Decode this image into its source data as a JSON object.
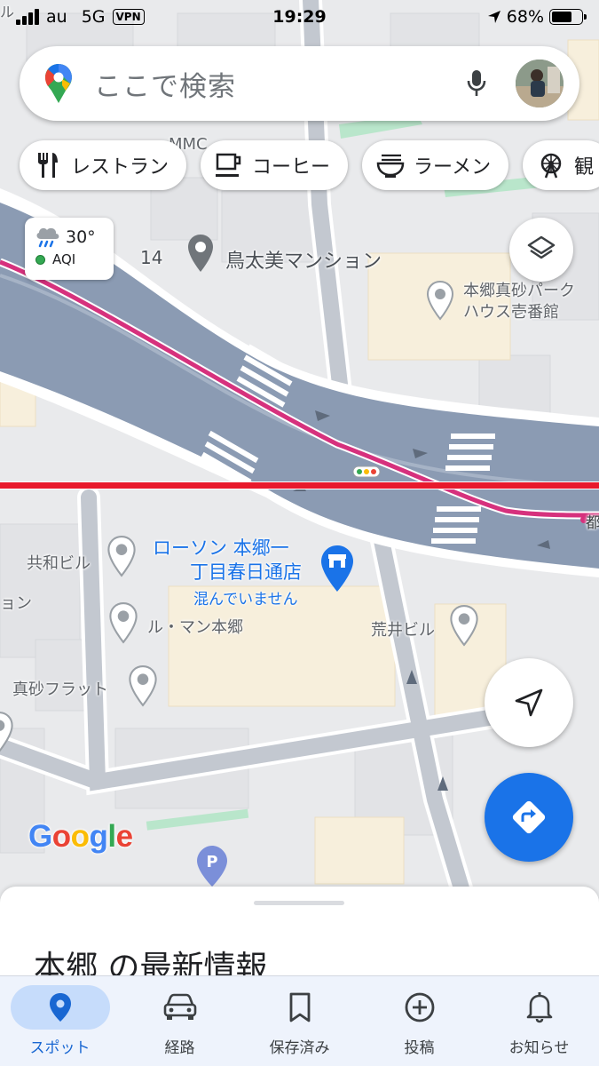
{
  "status_bar": {
    "carrier": "au",
    "network": "5G",
    "vpn": "VPN",
    "time": "19:29",
    "battery": "68%",
    "battery_level": 0.68
  },
  "search": {
    "placeholder": "ここで検索"
  },
  "chips": [
    {
      "label": "レストラン",
      "icon": "fork-knife-icon"
    },
    {
      "label": "コーヒー",
      "icon": "coffee-cup-icon"
    },
    {
      "label": "ラーメン",
      "icon": "ramen-bowl-icon"
    },
    {
      "label": "観",
      "icon": "ferris-wheel-icon"
    }
  ],
  "weather": {
    "temp": "30°",
    "aqi": "AQI",
    "icon": "rain-cloud-icon",
    "aqi_color": "#34a853"
  },
  "map": {
    "labels": {
      "mmc": "MMC",
      "num14": "14",
      "tori_mansion": "鳥太美マンション",
      "hongo_park": "本郷真砂パーク\nハウス壱番館",
      "lawson_line1": "ローソン 本郷一",
      "lawson_line2": "丁目春日通店",
      "lawson_crowd": "混んでいません",
      "kyowa": "共和ビル",
      "ru_man": "ル・マン本郷",
      "arai": "荒井ビル",
      "masago_flat": "真砂フラット",
      "yon": "ョン",
      "to": "都",
      "top_left": "ル"
    },
    "route_colors": {
      "magenta": "#d6317d",
      "red": "#e8192c"
    }
  },
  "google_logo": {
    "letters": [
      "G",
      "o",
      "o",
      "g",
      "l",
      "e"
    ],
    "colors": [
      "#4285f4",
      "#ea4335",
      "#fbbc05",
      "#4285f4",
      "#34a853",
      "#ea4335"
    ]
  },
  "sheet": {
    "title": "本郷 の最新情報"
  },
  "nav": [
    {
      "label": "スポット",
      "icon": "location-pin-icon",
      "active": true
    },
    {
      "label": "経路",
      "icon": "car-icon",
      "active": false
    },
    {
      "label": "保存済み",
      "icon": "bookmark-icon",
      "active": false
    },
    {
      "label": "投稿",
      "icon": "add-circle-icon",
      "active": false
    },
    {
      "label": "お知らせ",
      "icon": "bell-icon",
      "active": false
    }
  ],
  "colors": {
    "accent": "#1a73e8",
    "nav_bg": "#eef3fc",
    "nav_active": "#c6dcfb"
  }
}
